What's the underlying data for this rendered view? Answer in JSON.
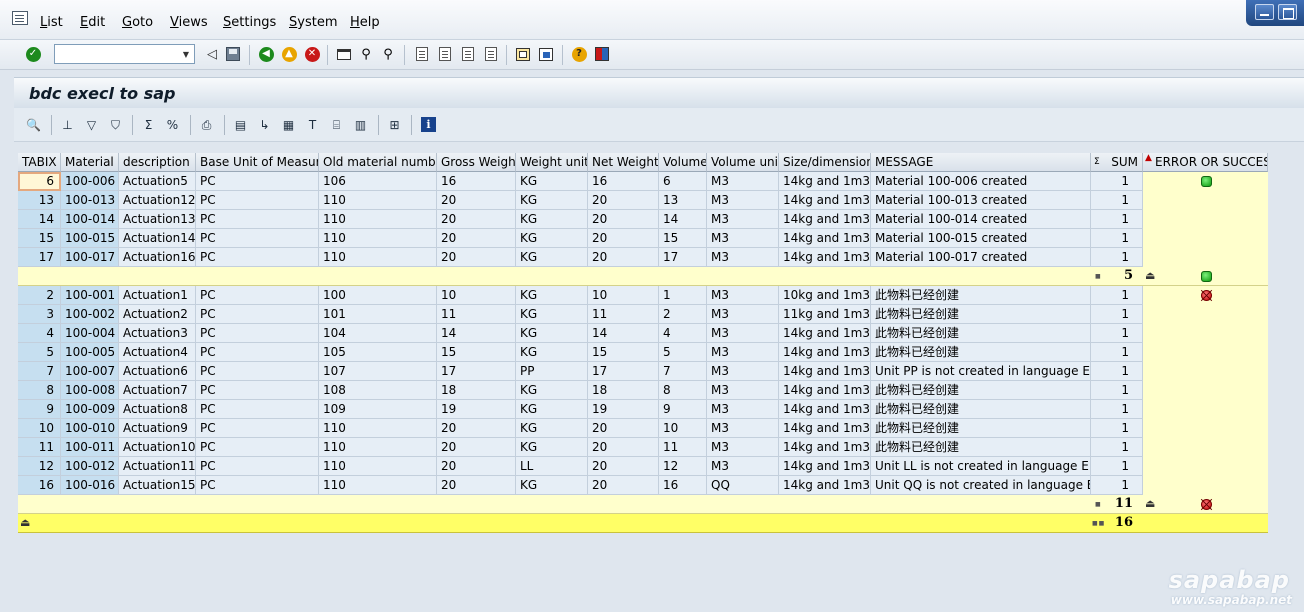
{
  "menu": {
    "items": [
      {
        "key": "L",
        "rest": "ist"
      },
      {
        "key": "E",
        "rest": "dit"
      },
      {
        "key": "G",
        "rest": "oto"
      },
      {
        "key": "V",
        "rest": "iews"
      },
      {
        "key": "S",
        "rest": "ettings"
      },
      {
        "key": "S",
        "rest": "ystem"
      },
      {
        "key": "H",
        "rest": "elp"
      }
    ]
  },
  "toolbar": {
    "command_field_value": "",
    "icons": [
      "enter-check-icon",
      "back-triangle-icon",
      "save-icon",
      "back-icon",
      "exit-icon",
      "cancel-icon",
      "print-icon",
      "find-icon",
      "find-next-icon",
      "first-page-icon",
      "previous-page-icon",
      "next-page-icon",
      "last-page-icon",
      "create-session-icon",
      "shortcut-icon",
      "help-icon",
      "layout-icon"
    ]
  },
  "title": "bdc execl to sap",
  "grid": {
    "columns": {
      "tabix": "TABIX",
      "material": "Material",
      "description": "description",
      "base_unit": "Base Unit of Measure",
      "old_material": "Old material number",
      "gross_weight": "Gross Weight",
      "weight_unit": "Weight unit",
      "net_weight": "Net Weight",
      "volume": "Volume",
      "volume_unit": "Volume unit",
      "size": "Size/dimensions",
      "message": "MESSAGE",
      "sum_sigma": "Σ",
      "sum": "SUM",
      "status": "ERROR OR SUCCESS"
    },
    "groups": [
      {
        "status": "success",
        "subtotal": "5",
        "rows": [
          {
            "tabix": "6",
            "material": "100-006",
            "description": "Actuation5",
            "base_unit": "PC",
            "old_material": "106",
            "gross_weight": "16",
            "weight_unit": "KG",
            "net_weight": "16",
            "volume": "6",
            "volume_unit": "M3",
            "size": "14kg and 1m3",
            "message": "Material 100-006 created",
            "sum": "1"
          },
          {
            "tabix": "13",
            "material": "100-013",
            "description": "Actuation12",
            "base_unit": "PC",
            "old_material": "110",
            "gross_weight": "20",
            "weight_unit": "KG",
            "net_weight": "20",
            "volume": "13",
            "volume_unit": "M3",
            "size": "14kg and 1m3",
            "message": "Material 100-013 created",
            "sum": "1"
          },
          {
            "tabix": "14",
            "material": "100-014",
            "description": "Actuation13",
            "base_unit": "PC",
            "old_material": "110",
            "gross_weight": "20",
            "weight_unit": "KG",
            "net_weight": "20",
            "volume": "14",
            "volume_unit": "M3",
            "size": "14kg and 1m3",
            "message": "Material 100-014 created",
            "sum": "1"
          },
          {
            "tabix": "15",
            "material": "100-015",
            "description": "Actuation14",
            "base_unit": "PC",
            "old_material": "110",
            "gross_weight": "20",
            "weight_unit": "KG",
            "net_weight": "20",
            "volume": "15",
            "volume_unit": "M3",
            "size": "14kg and 1m3",
            "message": "Material 100-015 created",
            "sum": "1"
          },
          {
            "tabix": "17",
            "material": "100-017",
            "description": "Actuation16",
            "base_unit": "PC",
            "old_material": "110",
            "gross_weight": "20",
            "weight_unit": "KG",
            "net_weight": "20",
            "volume": "17",
            "volume_unit": "M3",
            "size": "14kg and 1m3",
            "message": "Material 100-017 created",
            "sum": "1"
          }
        ]
      },
      {
        "status": "error",
        "subtotal": "11",
        "rows": [
          {
            "tabix": "2",
            "material": "100-001",
            "description": "Actuation1",
            "base_unit": "PC",
            "old_material": "100",
            "gross_weight": "10",
            "weight_unit": "KG",
            "net_weight": "10",
            "volume": "1",
            "volume_unit": "M3",
            "size": "10kg and 1m3",
            "message": "此物料已经创建",
            "sum": "1"
          },
          {
            "tabix": "3",
            "material": "100-002",
            "description": "Actuation2",
            "base_unit": "PC",
            "old_material": "101",
            "gross_weight": "11",
            "weight_unit": "KG",
            "net_weight": "11",
            "volume": "2",
            "volume_unit": "M3",
            "size": "11kg and 1m3",
            "message": "此物料已经创建",
            "sum": "1"
          },
          {
            "tabix": "4",
            "material": "100-004",
            "description": "Actuation3",
            "base_unit": "PC",
            "old_material": "104",
            "gross_weight": "14",
            "weight_unit": "KG",
            "net_weight": "14",
            "volume": "4",
            "volume_unit": "M3",
            "size": "14kg and 1m3",
            "message": "此物料已经创建",
            "sum": "1"
          },
          {
            "tabix": "5",
            "material": "100-005",
            "description": "Actuation4",
            "base_unit": "PC",
            "old_material": "105",
            "gross_weight": "15",
            "weight_unit": "KG",
            "net_weight": "15",
            "volume": "5",
            "volume_unit": "M3",
            "size": "14kg and 1m3",
            "message": "此物料已经创建",
            "sum": "1"
          },
          {
            "tabix": "7",
            "material": "100-007",
            "description": "Actuation6",
            "base_unit": "PC",
            "old_material": "107",
            "gross_weight": "17",
            "weight_unit": "PP",
            "net_weight": "17",
            "volume": "7",
            "volume_unit": "M3",
            "size": "14kg and 1m3",
            "message": "Unit PP is not created in language EN",
            "sum": "1"
          },
          {
            "tabix": "8",
            "material": "100-008",
            "description": "Actuation7",
            "base_unit": "PC",
            "old_material": "108",
            "gross_weight": "18",
            "weight_unit": "KG",
            "net_weight": "18",
            "volume": "8",
            "volume_unit": "M3",
            "size": "14kg and 1m3",
            "message": "此物料已经创建",
            "sum": "1"
          },
          {
            "tabix": "9",
            "material": "100-009",
            "description": "Actuation8",
            "base_unit": "PC",
            "old_material": "109",
            "gross_weight": "19",
            "weight_unit": "KG",
            "net_weight": "19",
            "volume": "9",
            "volume_unit": "M3",
            "size": "14kg and 1m3",
            "message": "此物料已经创建",
            "sum": "1"
          },
          {
            "tabix": "10",
            "material": "100-010",
            "description": "Actuation9",
            "base_unit": "PC",
            "old_material": "110",
            "gross_weight": "20",
            "weight_unit": "KG",
            "net_weight": "20",
            "volume": "10",
            "volume_unit": "M3",
            "size": "14kg and 1m3",
            "message": "此物料已经创建",
            "sum": "1"
          },
          {
            "tabix": "11",
            "material": "100-011",
            "description": "Actuation10",
            "base_unit": "PC",
            "old_material": "110",
            "gross_weight": "20",
            "weight_unit": "KG",
            "net_weight": "20",
            "volume": "11",
            "volume_unit": "M3",
            "size": "14kg and 1m3",
            "message": "此物料已经创建",
            "sum": "1"
          },
          {
            "tabix": "12",
            "material": "100-012",
            "description": "Actuation11",
            "base_unit": "PC",
            "old_material": "110",
            "gross_weight": "20",
            "weight_unit": "LL",
            "net_weight": "20",
            "volume": "12",
            "volume_unit": "M3",
            "size": "14kg and 1m3",
            "message": "Unit LL is not created in language EN",
            "sum": "1"
          },
          {
            "tabix": "16",
            "material": "100-016",
            "description": "Actuation15",
            "base_unit": "PC",
            "old_material": "110",
            "gross_weight": "20",
            "weight_unit": "KG",
            "net_weight": "20",
            "volume": "16",
            "volume_unit": "QQ",
            "size": "14kg and 1m3",
            "message": "Unit QQ is not created in language EN",
            "sum": "1"
          }
        ]
      }
    ],
    "grand_total": "16"
  },
  "colors": {
    "key_column_bg": "#c6dff0",
    "cell_bg": "#e6eef6",
    "subtotal_bg": "#ffffcc",
    "total_bg": "#ffff66",
    "success_led": "#0c9a0c",
    "error_led": "#c00000"
  },
  "watermark": {
    "logo": "sapabap",
    "url": "www.sapabap.net"
  }
}
